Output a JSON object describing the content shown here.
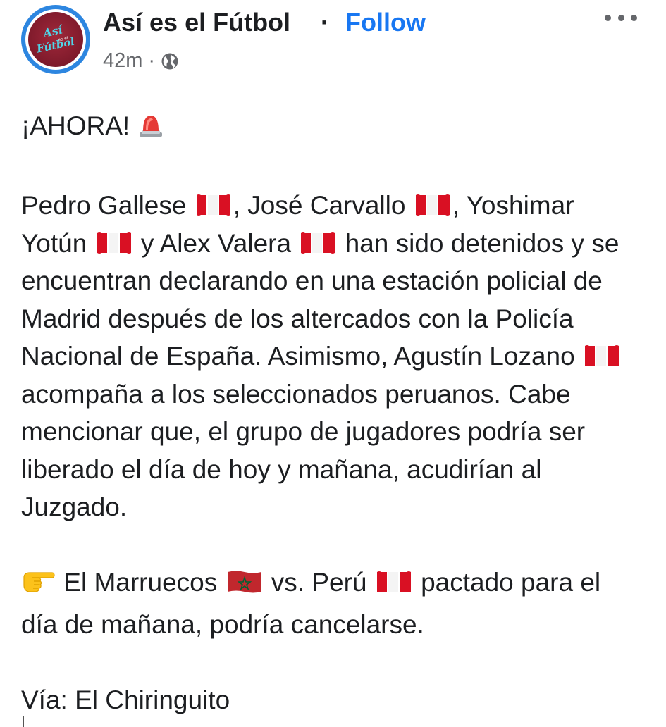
{
  "post": {
    "page_name": "Así es el Fútbol",
    "separator": "·",
    "follow_label": "Follow",
    "time": "42m",
    "meta_separator": "·",
    "privacy_icon": "globe-icon",
    "more_icon": "more-options-icon",
    "avatar_logo_text": "Así es el Fútbol"
  },
  "content": {
    "headline": "¡AHORA!",
    "headline_emoji": "rotating-light-emoji",
    "p1": {
      "t1": "Pedro Gallese",
      "t2": ", José Carvallo",
      "t3": ", Yoshimar Yotún",
      "t4": " y Alex Valera",
      "t5": " han sido detenidos y se encuentran declarando en una estación policial de Madrid después de los altercados con la Policía Nacional de España. Asimismo, Agustín Lozano",
      "t6": " acompaña a los seleccionados peruanos. Cabe mencionar que, el grupo de jugadores podría ser liberado el día de hoy y mañana, acudirían al Juzgado."
    },
    "p2": {
      "pointer_emoji": "backhand-index-pointing-right-emoji",
      "t1": " El Marruecos",
      "t2": " vs. Perú",
      "t3": " pactado para el día de mañana, podría cancelarse."
    },
    "source": "Vía: El Chiringuito"
  },
  "colors": {
    "follow": "#1877f2",
    "meta": "#65676b",
    "text": "#1c1e21",
    "avatar_ring": "#2d86e0",
    "avatar_fill": "#7e1a2b",
    "peru_red": "#d91023",
    "morocco_red": "#c1272d",
    "morocco_star": "#006233"
  }
}
